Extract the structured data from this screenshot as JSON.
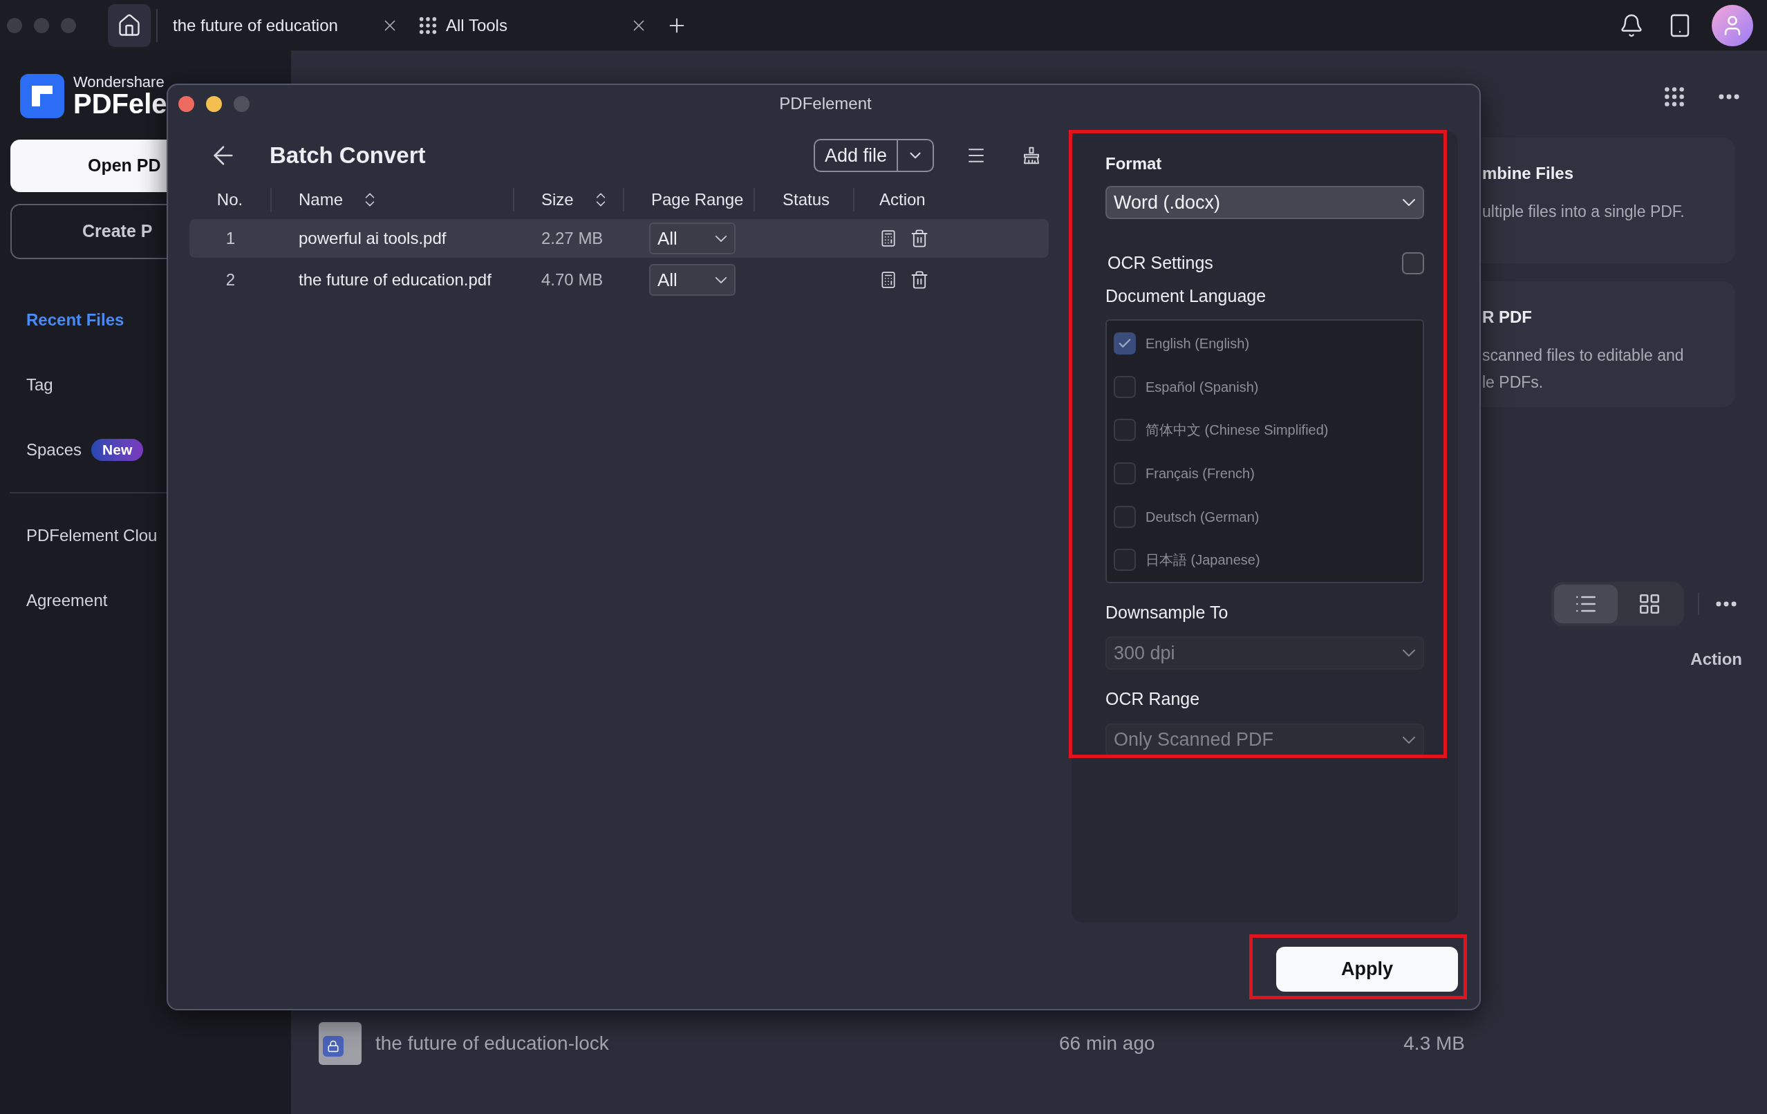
{
  "tab_bar": {
    "tabs": [
      {
        "kind": "home",
        "selected": true
      },
      {
        "kind": "document",
        "label": "the future of education",
        "selected": false
      },
      {
        "kind": "tools",
        "label": "All Tools",
        "selected": false
      }
    ]
  },
  "sidebar": {
    "brand_top": "Wondershare",
    "brand_name": "PDFele",
    "open_button": "Open PD",
    "create_button": "Create P",
    "items": [
      {
        "label": "Recent Files",
        "selected": true
      },
      {
        "label": "Tag",
        "selected": false
      },
      {
        "label": "Spaces",
        "badge": "New",
        "selected": false
      }
    ],
    "bottom_items": [
      {
        "label": "PDFelement Clou",
        "selected": false
      },
      {
        "label": "Agreement",
        "selected": false
      }
    ]
  },
  "main": {
    "cards": [
      {
        "title": "mbine Files",
        "description_lines": [
          "ultiple files into a single PDF."
        ]
      },
      {
        "title": "R PDF",
        "description_lines": [
          "scanned files to editable and",
          "le PDFs."
        ]
      }
    ],
    "view_options": [
      {
        "kind": "list",
        "selected": true
      },
      {
        "kind": "grid",
        "selected": false
      }
    ],
    "column_header": "Action",
    "files": [
      {
        "name": "the future of education-lock",
        "modified": "66 min ago",
        "size": "4.3 MB",
        "locked": true
      }
    ]
  },
  "dialog": {
    "title": "PDFelement",
    "heading": "Batch Convert",
    "add_file": "Add file",
    "columns": [
      {
        "label": "No.",
        "sortable": false
      },
      {
        "label": "Name",
        "sortable": true
      },
      {
        "label": "Size",
        "sortable": true
      },
      {
        "label": "Page Range",
        "sortable": false
      },
      {
        "label": "Status",
        "sortable": false
      },
      {
        "label": "Action",
        "sortable": false
      }
    ],
    "rows": [
      {
        "no": "1",
        "name": "powerful ai tools.pdf",
        "size": "2.27 MB",
        "page_range": "All",
        "selected": true
      },
      {
        "no": "2",
        "name": "the future of education.pdf",
        "size": "4.70 MB",
        "page_range": "All",
        "selected": false
      }
    ],
    "settings": {
      "highlighted": true,
      "format_label": "Format",
      "format": "Word (.docx)",
      "ocr_label": "OCR Settings",
      "ocr_enabled": false,
      "language_label": "Document Language",
      "languages": [
        {
          "label": "English (English)",
          "checked": true
        },
        {
          "label": "Español (Spanish)",
          "checked": false
        },
        {
          "label": "简体中文 (Chinese Simplified)",
          "checked": false
        },
        {
          "label": "Français (French)",
          "checked": false
        },
        {
          "label": "Deutsch (German)",
          "checked": false
        },
        {
          "label": "日本語 (Japanese)",
          "checked": false
        }
      ],
      "downsample_label": "Downsample To",
      "downsample": "300 dpi",
      "range_label": "OCR Range",
      "range": "Only Scanned PDF"
    },
    "apply": {
      "label": "Apply",
      "highlighted": true
    }
  }
}
